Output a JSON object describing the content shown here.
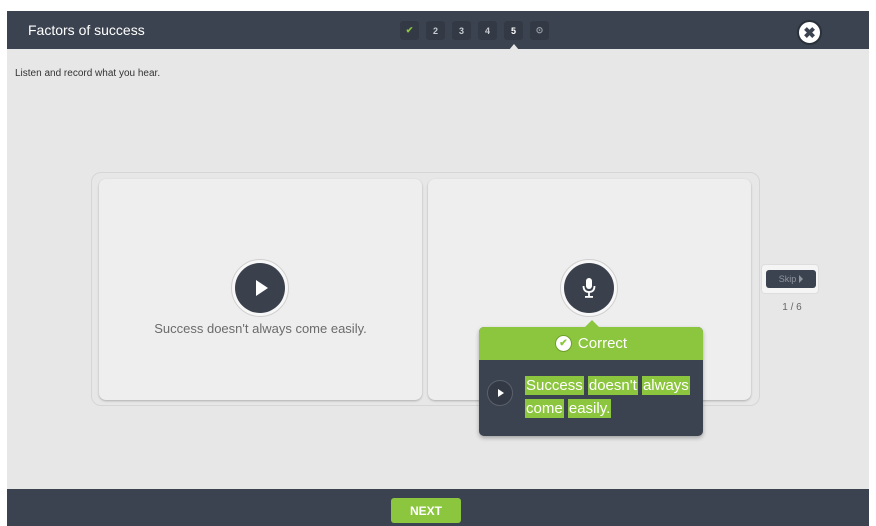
{
  "header": {
    "title": "Factors of success",
    "steps": [
      {
        "label": "✔",
        "state": "done"
      },
      {
        "label": "2",
        "state": "pending"
      },
      {
        "label": "3",
        "state": "pending"
      },
      {
        "label": "4",
        "state": "pending"
      },
      {
        "label": "5",
        "state": "current"
      },
      {
        "label": "⊙",
        "state": "finish"
      }
    ],
    "close_label": "✖"
  },
  "instruction": "Listen and record what you hear.",
  "listen_card": {
    "sentence": "Success doesn't always come easily."
  },
  "skip": {
    "label": "Skip",
    "counter": "1 / 6"
  },
  "feedback": {
    "status": "Correct",
    "check_icon": "✔",
    "words": [
      "Success",
      "doesn't",
      "always",
      "come",
      "easily."
    ]
  },
  "footer": {
    "next_label": "NEXT"
  },
  "colors": {
    "accent_green": "#8cc63f",
    "dark_bar": "#3c4350",
    "background": "#e7e7e7"
  }
}
